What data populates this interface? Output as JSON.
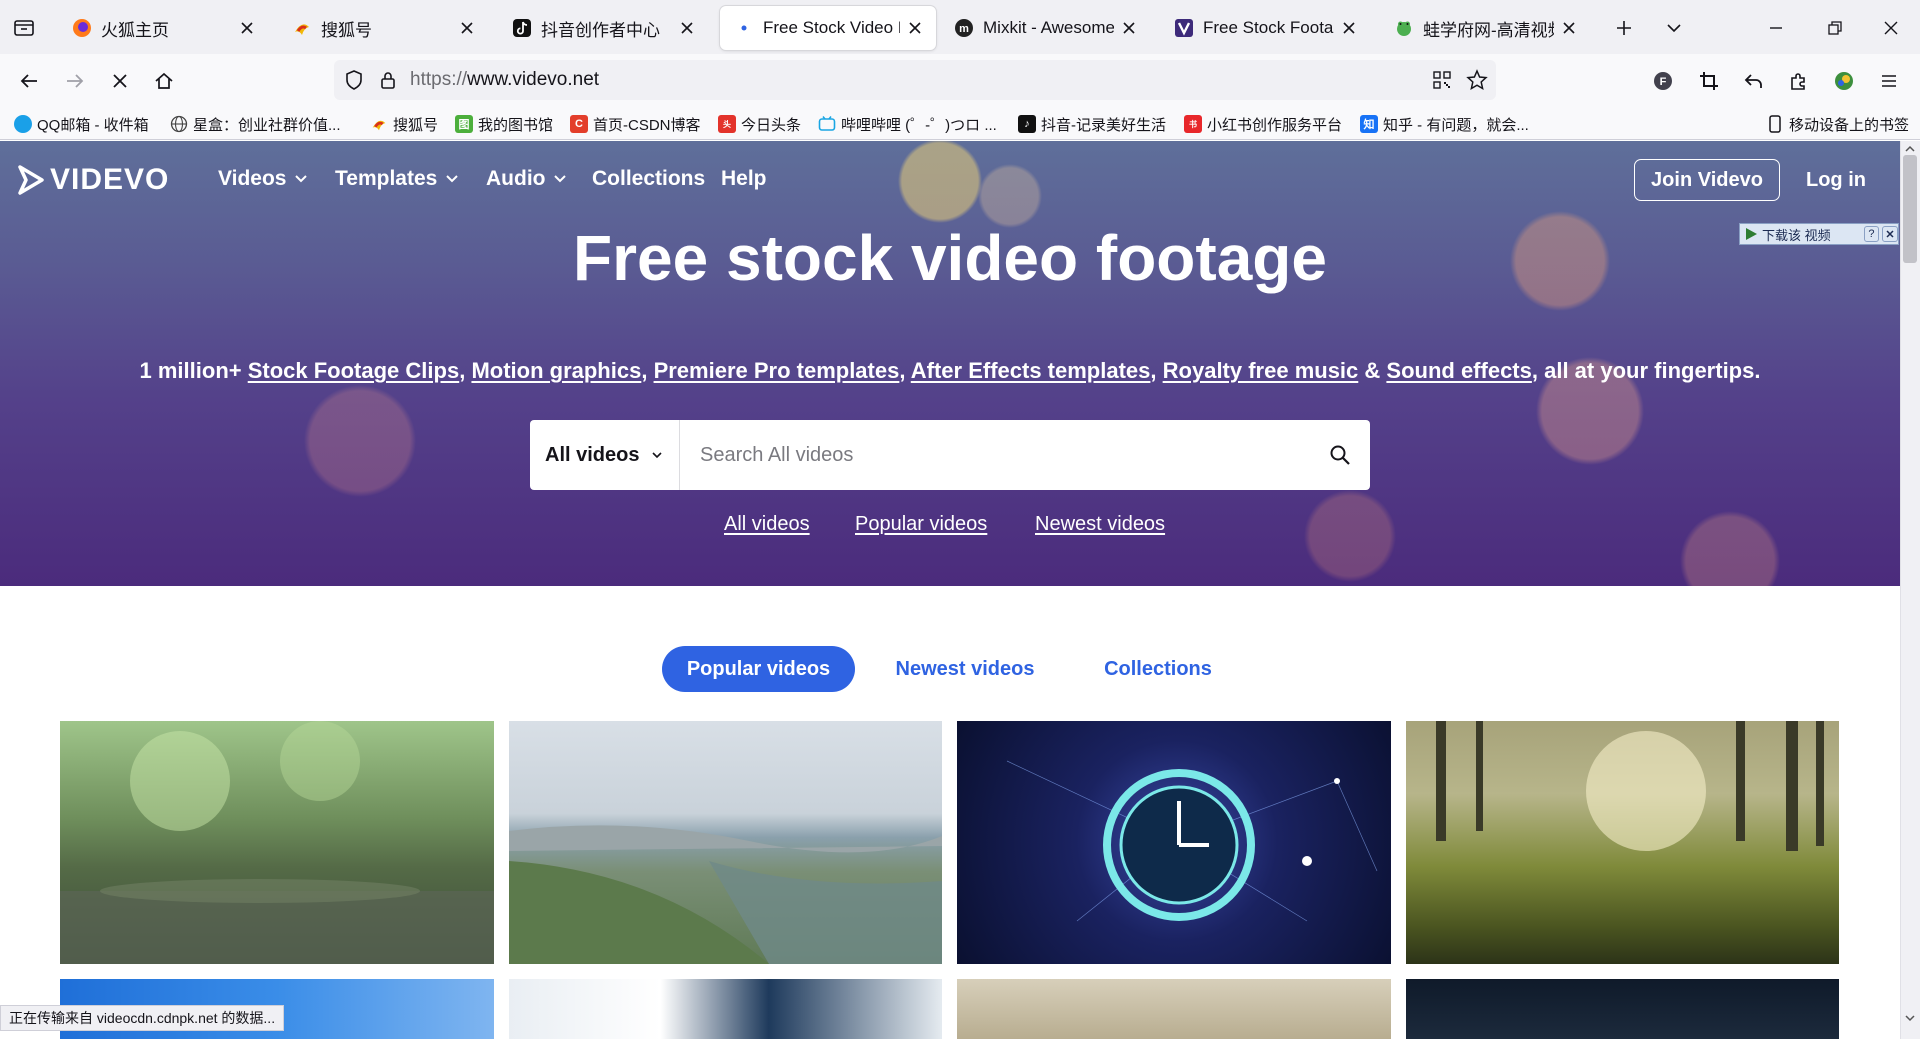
{
  "browser": {
    "tabs": [
      {
        "title": "火狐主页",
        "favicon": "firefox-icon",
        "active": false
      },
      {
        "title": "搜狐号",
        "favicon": "sohu-icon",
        "active": false
      },
      {
        "title": "抖音创作者中心",
        "favicon": "douyin-icon",
        "active": false
      },
      {
        "title": "Free Stock Video Foo",
        "favicon": "loading-dot-icon",
        "active": true
      },
      {
        "title": "Mixkit - Awesome fr",
        "favicon": "mixkit-icon",
        "active": false
      },
      {
        "title": "Free Stock Footage V",
        "favicon": "videvo-v-icon",
        "active": false
      },
      {
        "title": "蛙学府网-高清视频素",
        "favicon": "frog-icon",
        "active": false
      }
    ],
    "address_url": "https://www.videvo.net",
    "url_protocol": "https://",
    "url_host": "www.videvo.net",
    "bookmarks": [
      {
        "label": "QQ邮箱 - 收件箱",
        "icon": "qqmail-icon",
        "color": "#1aa0e8"
      },
      {
        "label": "星盒：创业社群价值...",
        "icon": "globe-icon",
        "color": "#555555"
      },
      {
        "label": "搜狐号",
        "icon": "sohu-icon",
        "color": "#e8a000"
      },
      {
        "label": "我的图书馆",
        "icon": "library-icon",
        "color": "#4caf3c"
      },
      {
        "label": "首页-CSDN博客",
        "icon": "csdn-icon",
        "color": "#e33e2b"
      },
      {
        "label": "今日头条",
        "icon": "toutiao-icon",
        "color": "#e3332b"
      },
      {
        "label": "哔哩哔哩 (゜-゜)つロ ...",
        "icon": "bilibili-icon",
        "color": "#1aa6e3"
      },
      {
        "label": "抖音-记录美好生活",
        "icon": "douyin-icon",
        "color": "#111111"
      },
      {
        "label": "小红书创作服务平台",
        "icon": "xiaohongshu-icon",
        "color": "#e8272b"
      },
      {
        "label": "知乎 - 有问题，就会...",
        "icon": "zhihu-icon",
        "color": "#1772f6"
      }
    ],
    "mobile_bookmarks": "移动设备上的书签",
    "status_text": "正在传输来自 videocdn.cdnpk.net 的数据..."
  },
  "site": {
    "brand": "VIDEVO",
    "nav": [
      {
        "label": "Videos",
        "dropdown": true
      },
      {
        "label": "Templates",
        "dropdown": true
      },
      {
        "label": "Audio",
        "dropdown": true
      },
      {
        "label": "Collections",
        "dropdown": false
      },
      {
        "label": "Help",
        "dropdown": false
      }
    ],
    "join_label": "Join Videvo",
    "login_label": "Log in",
    "download_bar_label": "下载该 视频",
    "download_bar_help": "?",
    "hero": {
      "title": "Free stock video footage",
      "sub_prefix": "1 million+ ",
      "sub_links": [
        "Stock Footage Clips",
        "Motion graphics",
        "Premiere Pro templates",
        "After Effects templates",
        "Royalty free music",
        "Sound effects"
      ],
      "sub_seps": [
        ", ",
        ", ",
        ", ",
        ", ",
        " & "
      ],
      "sub_suffix": ", all at your fingertips."
    },
    "search": {
      "category": "All videos",
      "placeholder": "Search All videos"
    },
    "quick_links": [
      "All videos",
      "Popular videos",
      "Newest videos"
    ],
    "content_tabs": [
      {
        "label": "Popular videos",
        "active": true
      },
      {
        "label": "Newest videos",
        "active": false
      },
      {
        "label": "Collections",
        "active": false
      }
    ],
    "thumbnails": [
      {
        "subject": "rain-on-grass",
        "colors": [
          "#9fc58a",
          "#556b47",
          "#2e3a2a"
        ]
      },
      {
        "subject": "rocky-coastline",
        "colors": [
          "#c9d2da",
          "#7a8f76",
          "#5f7a56"
        ]
      },
      {
        "subject": "glowing-clock",
        "colors": [
          "#0a1030",
          "#3a4aa8",
          "#7be8e8"
        ]
      },
      {
        "subject": "forest-grass-sunlight",
        "colors": [
          "#b7b58a",
          "#6f7a2f",
          "#2c3318"
        ]
      }
    ]
  }
}
